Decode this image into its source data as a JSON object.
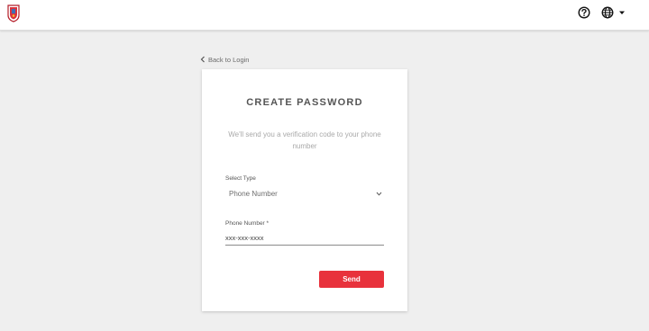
{
  "header": {
    "logo_icon": "crest-logo-icon",
    "help_icon": "help-circle-icon",
    "language_icon": "globe-icon",
    "language_dropdown_icon": "caret-down-icon"
  },
  "back_link": {
    "label": "Back to Login",
    "icon": "chevron-left-icon"
  },
  "card": {
    "title": "CREATE PASSWORD",
    "subtitle": "We'll send you a verification code to your phone number",
    "select_type": {
      "label": "Select Type",
      "value": "Phone Number",
      "icon": "chevron-down-icon"
    },
    "phone_number": {
      "label": "Phone Number *",
      "placeholder": "xxx-xxx-xxxx",
      "value": ""
    },
    "send_button": {
      "label": "Send"
    }
  },
  "colors": {
    "background": "#efefef",
    "card": "#ffffff",
    "accent": "#e8323c",
    "title_text": "#555555",
    "muted_text": "#a9a9a9"
  }
}
